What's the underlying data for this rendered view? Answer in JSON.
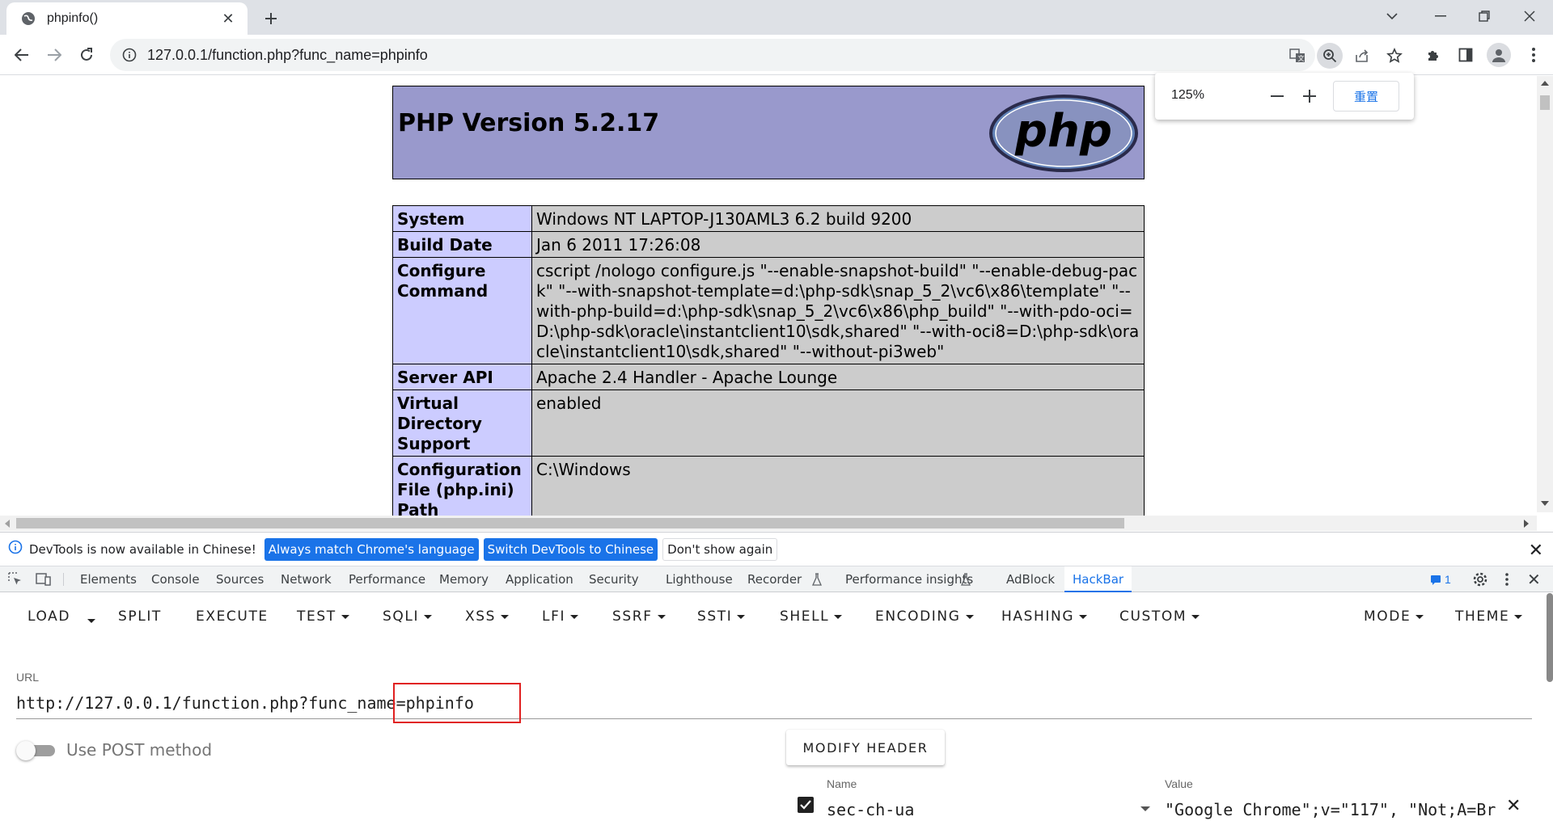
{
  "browser": {
    "tab_title": "phpinfo()",
    "url": "127.0.0.1/function.php?func_name=phpinfo",
    "zoom": {
      "level": "125%",
      "reset_label": "重置"
    }
  },
  "php": {
    "version_title": "PHP Version 5.2.17",
    "logo_text": "php",
    "rows": [
      {
        "key": "System",
        "value": "Windows NT LAPTOP-J130AML3 6.2 build 9200"
      },
      {
        "key": "Build Date",
        "value": "Jan 6 2011 17:26:08"
      },
      {
        "key": "Configure Command",
        "value": "cscript /nologo configure.js \"--enable-snapshot-build\" \"--enable-debug-pack\" \"--with-snapshot-template=d:\\php-sdk\\snap_5_2\\vc6\\x86\\template\" \"--with-php-build=d:\\php-sdk\\snap_5_2\\vc6\\x86\\php_build\" \"--with-pdo-oci=D:\\php-sdk\\oracle\\instantclient10\\sdk,shared\" \"--with-oci8=D:\\php-sdk\\oracle\\instantclient10\\sdk,shared\" \"--without-pi3web\""
      },
      {
        "key": "Server API",
        "value": "Apache 2.4 Handler - Apache Lounge"
      },
      {
        "key": "Virtual Directory Support",
        "value": "enabled"
      },
      {
        "key": "Configuration File (php.ini) Path",
        "value": "C:\\Windows"
      }
    ]
  },
  "devtools": {
    "infobar": {
      "message": "DevTools is now available in Chinese!",
      "btn_match": "Always match Chrome's language",
      "btn_switch": "Switch DevTools to Chinese",
      "btn_dismiss": "Don't show again"
    },
    "tabs": [
      "Elements",
      "Console",
      "Sources",
      "Network",
      "Performance",
      "Memory",
      "Application",
      "Security",
      "Lighthouse",
      "Recorder",
      "Performance insights",
      "AdBlock",
      "HackBar"
    ],
    "issues_count": "1"
  },
  "hackbar": {
    "menu": {
      "load": "LOAD",
      "split": "SPLIT",
      "execute": "EXECUTE",
      "test": "TEST",
      "sqli": "SQLI",
      "xss": "XSS",
      "lfi": "LFI",
      "ssrf": "SSRF",
      "ssti": "SSTI",
      "shell": "SHELL",
      "encoding": "ENCODING",
      "hashing": "HASHING",
      "custom": "CUSTOM",
      "mode": "MODE",
      "theme": "THEME"
    },
    "url_label": "URL",
    "url_value": "http://127.0.0.1/function.php?func_name=phpinfo",
    "post_label": "Use POST method",
    "modify_header": "MODIFY HEADER",
    "header": {
      "name_label": "Name",
      "value_label": "Value",
      "name": "sec-ch-ua",
      "value": "\"Google Chrome\";v=\"117\", \"Not;A=Br"
    }
  },
  "colors": {
    "php_header": "#9999cc",
    "php_key": "#ccccff",
    "php_value": "#cccccc",
    "accent": "#1a73e8",
    "highlight_box": "#e02020"
  }
}
